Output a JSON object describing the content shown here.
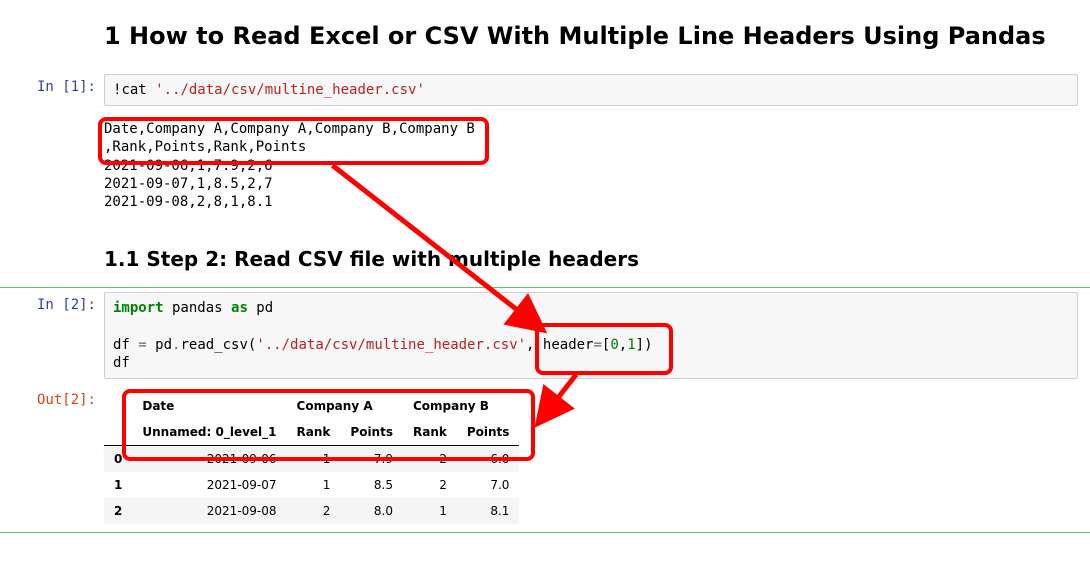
{
  "annotations": {
    "color": "#ff0000"
  },
  "heading1": "1  How to Read Excel or CSV With Multiple Line Headers Using Pandas",
  "heading2": "1.1  Step 2: Read CSV file with multiple headers",
  "cell1": {
    "prompt": "In [1]:",
    "code_plain": "!cat '../data/csv/multine_header.csv'",
    "code": {
      "bang": "!",
      "cmd": "cat ",
      "str": "'../data/csv/multine_header.csv'"
    },
    "output_lines": [
      "Date,Company A,Company A,Company B,Company B",
      ",Rank,Points,Rank,Points",
      "2021-09-06,1,7.9,2,6",
      "2021-09-07,1,8.5,2,7",
      "2021-09-08,2,8,1,8.1"
    ]
  },
  "cell2": {
    "prompt": "In [2]:",
    "out_prompt": "Out[2]:",
    "code_plain": "import pandas as pd\n\ndf = pd.read_csv('../data/csv/multine_header.csv', header=[0,1])\ndf",
    "code": {
      "l1_kw1": "import",
      "l1_mod": " pandas ",
      "l1_kw2": "as",
      "l1_alias": " pd",
      "l3_pre": "df ",
      "l3_eq": "=",
      "l3_mid": " pd",
      "l3_dot1": ".",
      "l3_fn": "read_csv(",
      "l3_str": "'../data/csv/multine_header.csv'",
      "l3_comma": ", ",
      "l3_kwarg": "header",
      "l3_eq2": "=",
      "l3_br1": "[",
      "l3_n0": "0",
      "l3_c2": ",",
      "l3_n1": "1",
      "l3_br2": "])",
      "l4": "df"
    },
    "table": {
      "head_top": [
        "",
        "Date",
        "Company A",
        "",
        "Company B",
        ""
      ],
      "head_bot": [
        "",
        "Unnamed: 0_level_1",
        "Rank",
        "Points",
        "Rank",
        "Points"
      ],
      "rows": [
        {
          "idx": "0",
          "date": "2021-09-06",
          "a_rank": "1",
          "a_pts": "7.9",
          "b_rank": "2",
          "b_pts": "6.0"
        },
        {
          "idx": "1",
          "date": "2021-09-07",
          "a_rank": "1",
          "a_pts": "8.5",
          "b_rank": "2",
          "b_pts": "7.0"
        },
        {
          "idx": "2",
          "date": "2021-09-08",
          "a_rank": "2",
          "a_pts": "8.0",
          "b_rank": "1",
          "b_pts": "8.1"
        }
      ]
    }
  }
}
